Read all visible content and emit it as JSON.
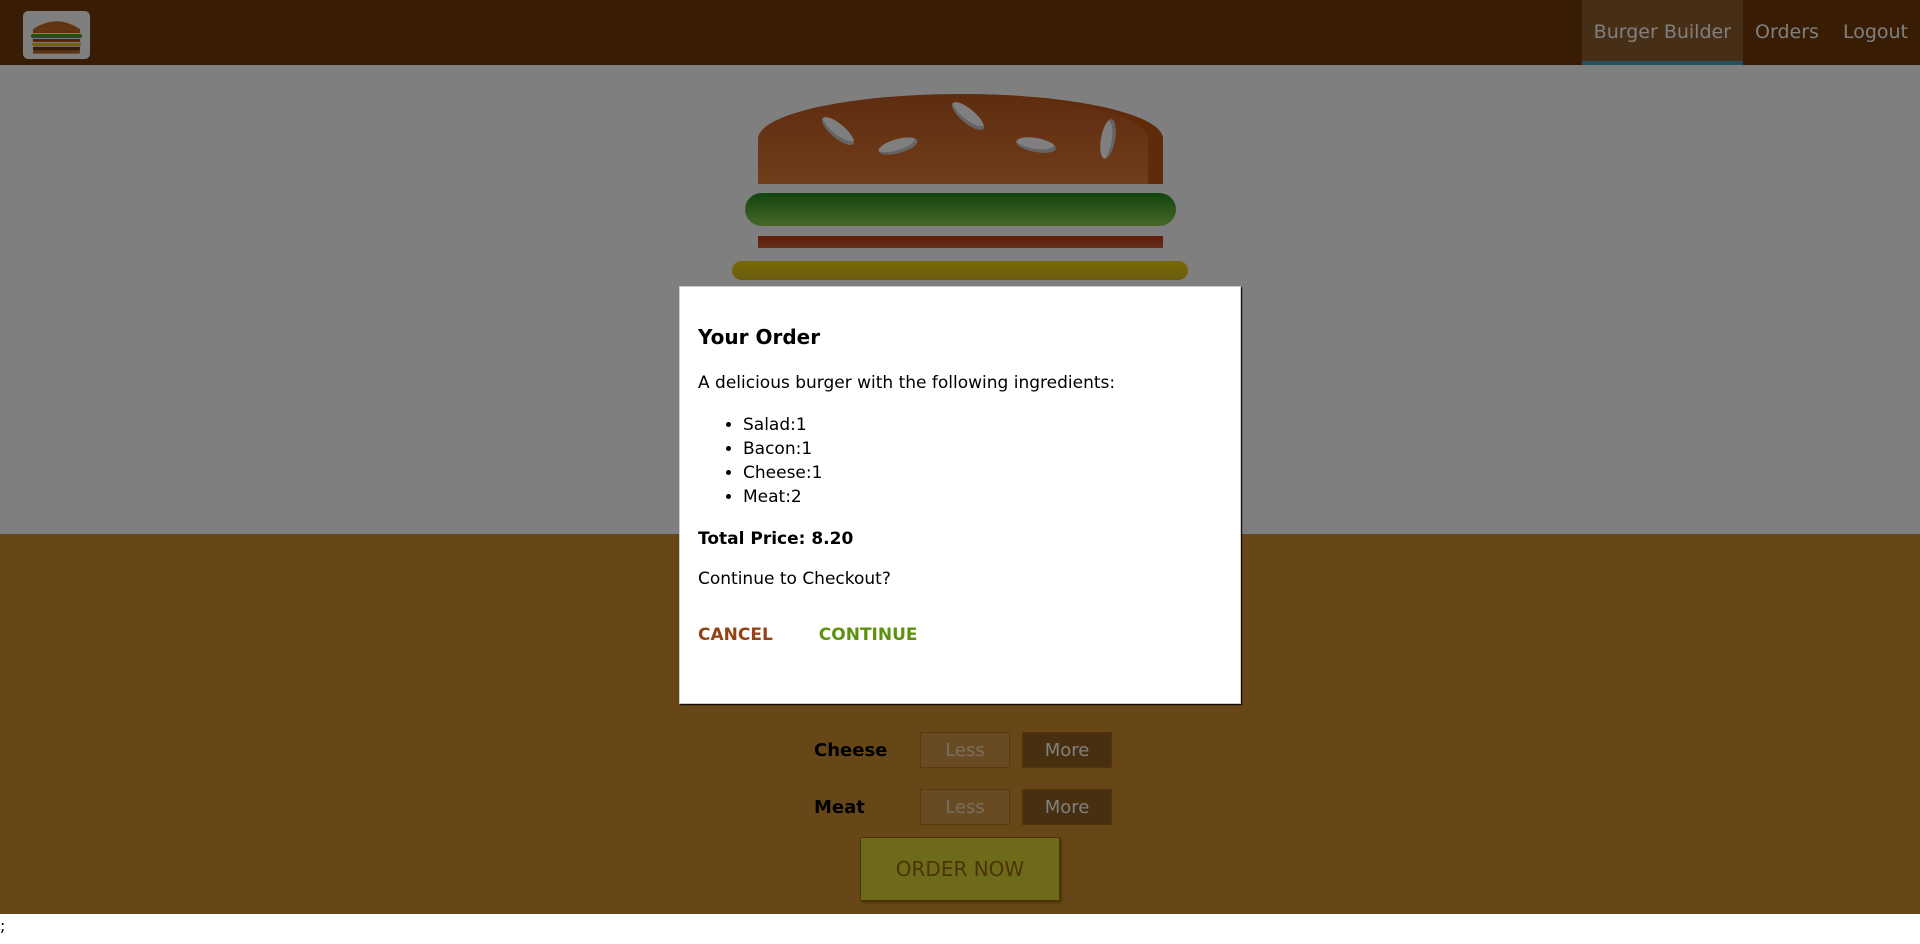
{
  "toolbar": {
    "nav": [
      {
        "label": "Burger Builder",
        "active": true
      },
      {
        "label": "Orders",
        "active": false
      },
      {
        "label": "Logout",
        "active": false
      }
    ]
  },
  "controls": {
    "rows": [
      {
        "label": "Cheese",
        "less": "Less",
        "more": "More"
      },
      {
        "label": "Meat",
        "less": "Less",
        "more": "More"
      }
    ],
    "order_button": "ORDER NOW"
  },
  "footer": {
    "text": ";"
  },
  "modal": {
    "title": "Your Order",
    "intro": "A delicious burger with the following ingredients:",
    "ingredients": [
      "Salad:1",
      "Bacon:1",
      "Cheese:1",
      "Meat:2"
    ],
    "total_price": "Total Price: 8.20",
    "question": "Continue to Checkout?",
    "cancel_label": "CANCEL",
    "continue_label": "CONTINUE"
  }
}
